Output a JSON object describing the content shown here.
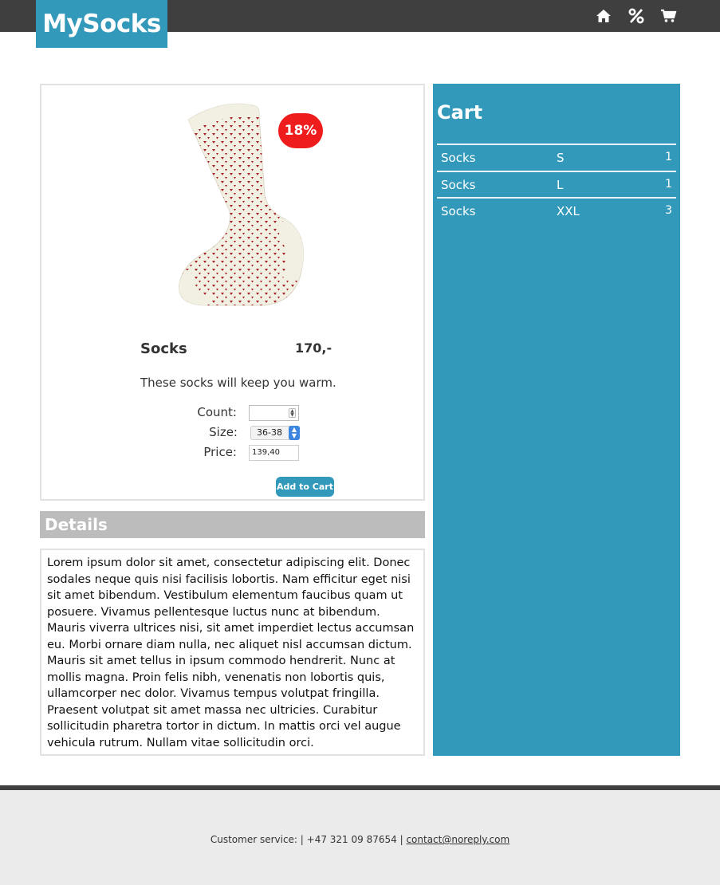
{
  "header": {
    "logo": "MySocks",
    "nav_icons": [
      "home-icon",
      "percent-icon",
      "cart-icon"
    ]
  },
  "product": {
    "discount": "18%",
    "name": "Socks",
    "price": "170,-",
    "description": "These socks will keep you warm.",
    "form": {
      "count_label": "Count:",
      "count_value": "",
      "size_label": "Size:",
      "size_value": "36-38",
      "price_label": "Price:",
      "price_value": "139,40"
    },
    "add_button": "Add to Cart"
  },
  "details": {
    "title": "Details",
    "text": "Lorem ipsum dolor sit amet, consectetur adipiscing elit. Donec sodales neque quis nisi facilisis lobortis. Nam efficitur eget nisi sit amet bibendum. Vestibulum elementum faucibus quam ut posuere. Vivamus pellentesque luctus nunc at bibendum. Mauris viverra ultrices nisi, sit amet imperdiet lectus accumsan eu. Morbi ornare diam nulla, nec aliquet nisl accumsan dictum. Mauris sit amet tellus in ipsum commodo hendrerit. Nunc at mollis magna. Proin felis nibh, venenatis non lobortis quis, ullamcorper nec dolor. Vivamus tempus volutpat fringilla. Praesent volutpat sit amet massa nec ultricies. Curabitur sollicitudin pharetra tortor in dictum. In mattis orci vel augue vehicula rutrum. Nullam vitae sollicitudin orci."
  },
  "cart": {
    "title": "Cart",
    "items": [
      {
        "name": "Socks",
        "size": "S",
        "qty": "1"
      },
      {
        "name": "Socks",
        "size": "L",
        "qty": "1"
      },
      {
        "name": "Socks",
        "size": "XXL",
        "qty": "3"
      }
    ]
  },
  "footer": {
    "text": "Customer service: | +47 321 09 87654 |",
    "email": "contact@noreply.com"
  },
  "colors": {
    "brand": "#3399bb",
    "topbar": "#3f3f3f",
    "badge": "#ee1c1c",
    "details_header": "#bcbcbc"
  }
}
